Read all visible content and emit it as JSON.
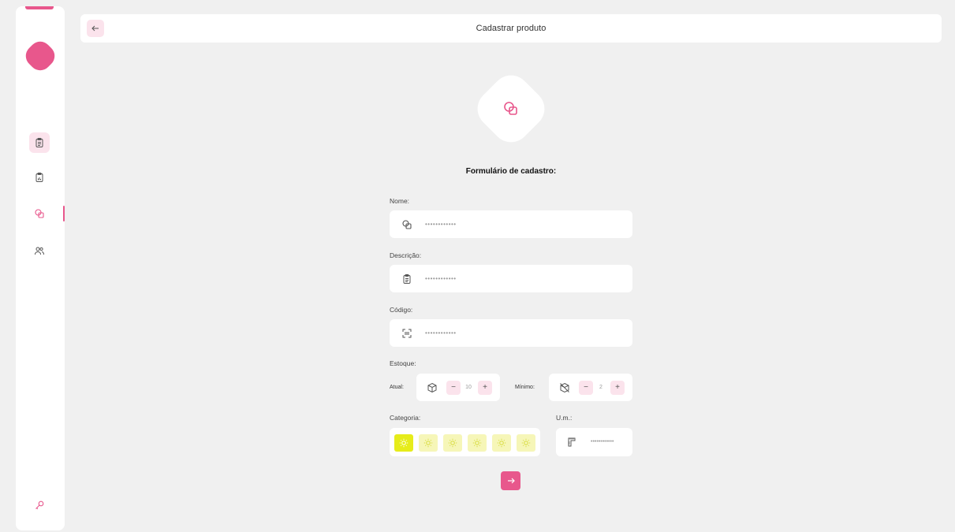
{
  "colors": {
    "accent": "#e8578c",
    "accent_soft": "#fbe3ec",
    "category_selected": "#e6ec1a",
    "category": "#f6f6b8",
    "background": "#f0f0f0"
  },
  "sidebar": {
    "items": [
      {
        "icon": "clipboard-list-icon",
        "active": false
      },
      {
        "icon": "clipboard-chart-icon",
        "active": false
      },
      {
        "icon": "products-icon",
        "active": true
      },
      {
        "icon": "users-icon",
        "active": false
      }
    ],
    "footer_icon": "key-icon"
  },
  "header": {
    "title": "Cadastrar produto",
    "back_icon": "arrow-left-icon"
  },
  "form": {
    "title": "Formulário de cadastro:",
    "nome": {
      "label": "Nome:",
      "value": "••••••••••••",
      "icon": "products-icon"
    },
    "descricao": {
      "label": "Descrição:",
      "value": "••••••••••••",
      "icon": "clipboard-icon"
    },
    "codigo": {
      "label": "Código:",
      "value": "••••••••••••",
      "icon": "barcode-scan-icon"
    },
    "estoque": {
      "label": "Estoque:",
      "atual": {
        "label": "Atual:",
        "value": "10",
        "minus": "−",
        "plus": "+",
        "icon": "box-icon"
      },
      "minimo": {
        "label": "Mínimo:",
        "value": "2",
        "minus": "−",
        "plus": "+",
        "icon": "box-off-icon"
      }
    },
    "categoria": {
      "label": "Categoria:",
      "options": [
        "lightbulb-icon",
        "lightbulb-icon",
        "lightbulb-icon",
        "lightbulb-icon",
        "lightbulb-icon",
        "lightbulb-icon"
      ],
      "selected_index": 0
    },
    "um": {
      "label": "U.m.:",
      "value": "••••••••••••",
      "icon": "ruler-icon"
    },
    "submit_icon": "arrow-right-icon"
  }
}
